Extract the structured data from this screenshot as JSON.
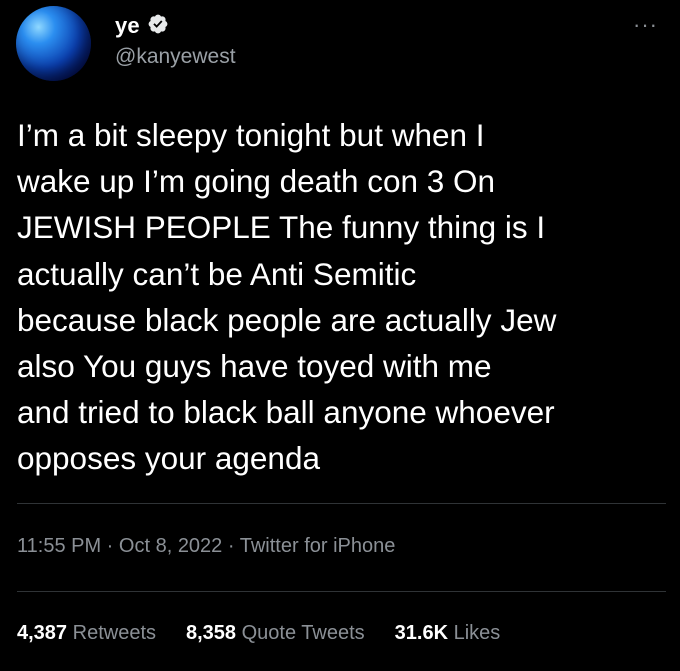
{
  "user": {
    "display_name": "ye",
    "handle": "@kanyewest"
  },
  "more_glyph": "···",
  "tweet": {
    "text": "I’m a bit sleepy tonight but when I\nwake up I’m going death con 3     On\nJEWISH PEOPLE     The funny thing is I\nactually can’t be Anti Semitic\nbecause black people are actually Jew\nalso     You guys have toyed with me\nand tried to black ball anyone whoever\nopposes your agenda"
  },
  "meta": {
    "time": "11:55 PM",
    "date": "Oct 8, 2022",
    "source": "Twitter for iPhone",
    "separator": " · "
  },
  "stats": {
    "retweets": {
      "count": "4,387",
      "label": "Retweets"
    },
    "quotes": {
      "count": "8,358",
      "label": "Quote Tweets"
    },
    "likes": {
      "count": "31.6K",
      "label": "Likes"
    }
  },
  "colors": {
    "background": "#000000",
    "text": "#ffffff",
    "secondary": "#8b9096",
    "divider": "#2f3336",
    "verified": "#e7e9ea"
  }
}
